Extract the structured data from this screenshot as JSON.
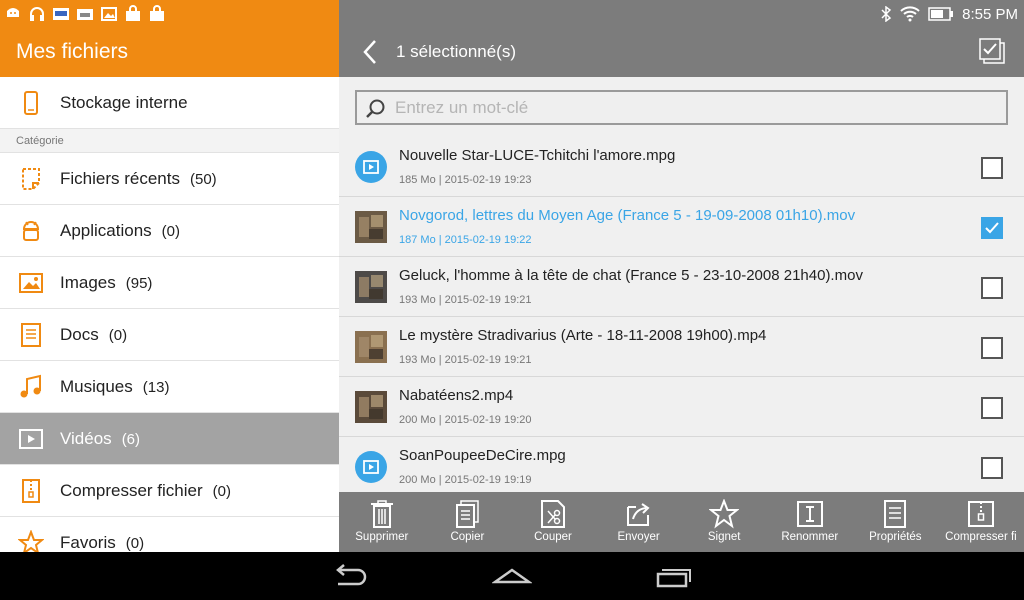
{
  "status_bar": {
    "time": "8:55 PM"
  },
  "left_panel": {
    "title": "Mes fichiers",
    "storage_label": "Stockage interne",
    "category_label": "Catégorie",
    "items": [
      {
        "label": "Fichiers récents",
        "count": "(50)",
        "icon": "recent-files-icon"
      },
      {
        "label": "Applications",
        "count": "(0)",
        "icon": "android-icon"
      },
      {
        "label": "Images",
        "count": "(95)",
        "icon": "image-icon"
      },
      {
        "label": "Docs",
        "count": "(0)",
        "icon": "document-icon"
      },
      {
        "label": "Musiques",
        "count": "(13)",
        "icon": "music-icon"
      },
      {
        "label": "Vidéos",
        "count": "(6)",
        "icon": "video-icon",
        "selected": true
      },
      {
        "label": "Compresser fichier",
        "count": "(0)",
        "icon": "zip-icon"
      },
      {
        "label": "Favoris",
        "count": "(0)",
        "icon": "star-icon"
      }
    ]
  },
  "header": {
    "selection_title": "1 sélectionné(s)"
  },
  "search": {
    "placeholder": "Entrez un mot-clé",
    "value": ""
  },
  "files": [
    {
      "name": "Nouvelle Star-LUCE-Tchitchi l'amore.mpg",
      "meta": "185 Mo | 2015-02-19 19:23",
      "thumb": "video-file-icon",
      "selected": false
    },
    {
      "name": "Novgorod, lettres du Moyen Age (France 5 - 19-09-2008 01h10).mov",
      "meta": "187 Mo | 2015-02-19 19:22",
      "thumb": "video-thumbnail",
      "selected": true
    },
    {
      "name": "Geluck, l'homme à la tête de chat (France 5 - 23-10-2008 21h40).mov",
      "meta": "193 Mo | 2015-02-19 19:21",
      "thumb": "video-thumbnail",
      "selected": false
    },
    {
      "name": "Le mystère Stradivarius (Arte - 18-11-2008 19h00).mp4",
      "meta": "193 Mo | 2015-02-19 19:21",
      "thumb": "video-thumbnail",
      "selected": false
    },
    {
      "name": "Nabatéens2.mp4",
      "meta": "200 Mo | 2015-02-19 19:20",
      "thumb": "video-thumbnail",
      "selected": false
    },
    {
      "name": "SoanPoupeeDeCire.mpg",
      "meta": "200 Mo | 2015-02-19 19:19",
      "thumb": "video-file-icon",
      "selected": false
    }
  ],
  "toolbar": [
    {
      "label": "Supprimer",
      "icon": "trash-icon"
    },
    {
      "label": "Copier",
      "icon": "copy-icon"
    },
    {
      "label": "Couper",
      "icon": "scissors-icon"
    },
    {
      "label": "Envoyer",
      "icon": "share-icon"
    },
    {
      "label": "Signet",
      "icon": "star-icon"
    },
    {
      "label": "Renommer",
      "icon": "rename-icon"
    },
    {
      "label": "Propriétés",
      "icon": "properties-icon"
    },
    {
      "label": "Compresser fi",
      "icon": "zip-icon"
    }
  ],
  "colors": {
    "accent": "#f08a12",
    "header_gray": "#7c7c7c",
    "selection_blue": "#3aa5e6"
  }
}
